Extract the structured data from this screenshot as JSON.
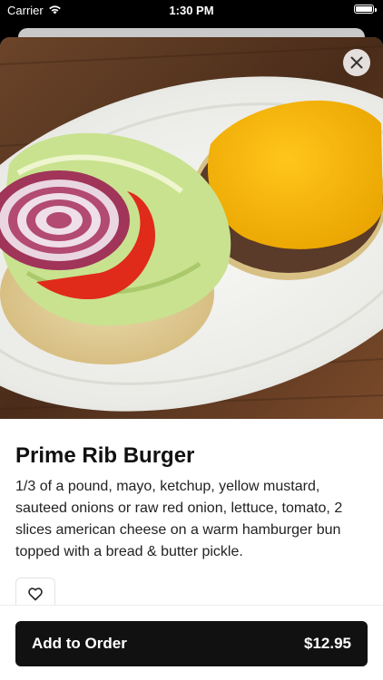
{
  "status_bar": {
    "carrier": "Carrier",
    "time": "1:30 PM",
    "battery_level": 1.0,
    "icons": [
      "wifi-icon",
      "battery-icon"
    ]
  },
  "item": {
    "image_subject": "burger-photo",
    "close_icon": "close-icon",
    "title": "Prime Rib Burger",
    "description": "1/3 of a pound, mayo, ketchup, yellow mustard, sauteed onions or raw red onion, lettuce, tomato, 2 slices american cheese on a warm hamburger bun topped with a bread & butter pickle.",
    "favorite_icon": "heart-icon"
  },
  "footer": {
    "add_label": "Add to Order",
    "price": "$12.95"
  },
  "colors": {
    "button_bg": "#111111",
    "button_text": "#ffffff",
    "cheese": "#f5b800",
    "tomato": "#e02a1a",
    "onion": "#9c2f55",
    "lettuce": "#c7e08a"
  }
}
